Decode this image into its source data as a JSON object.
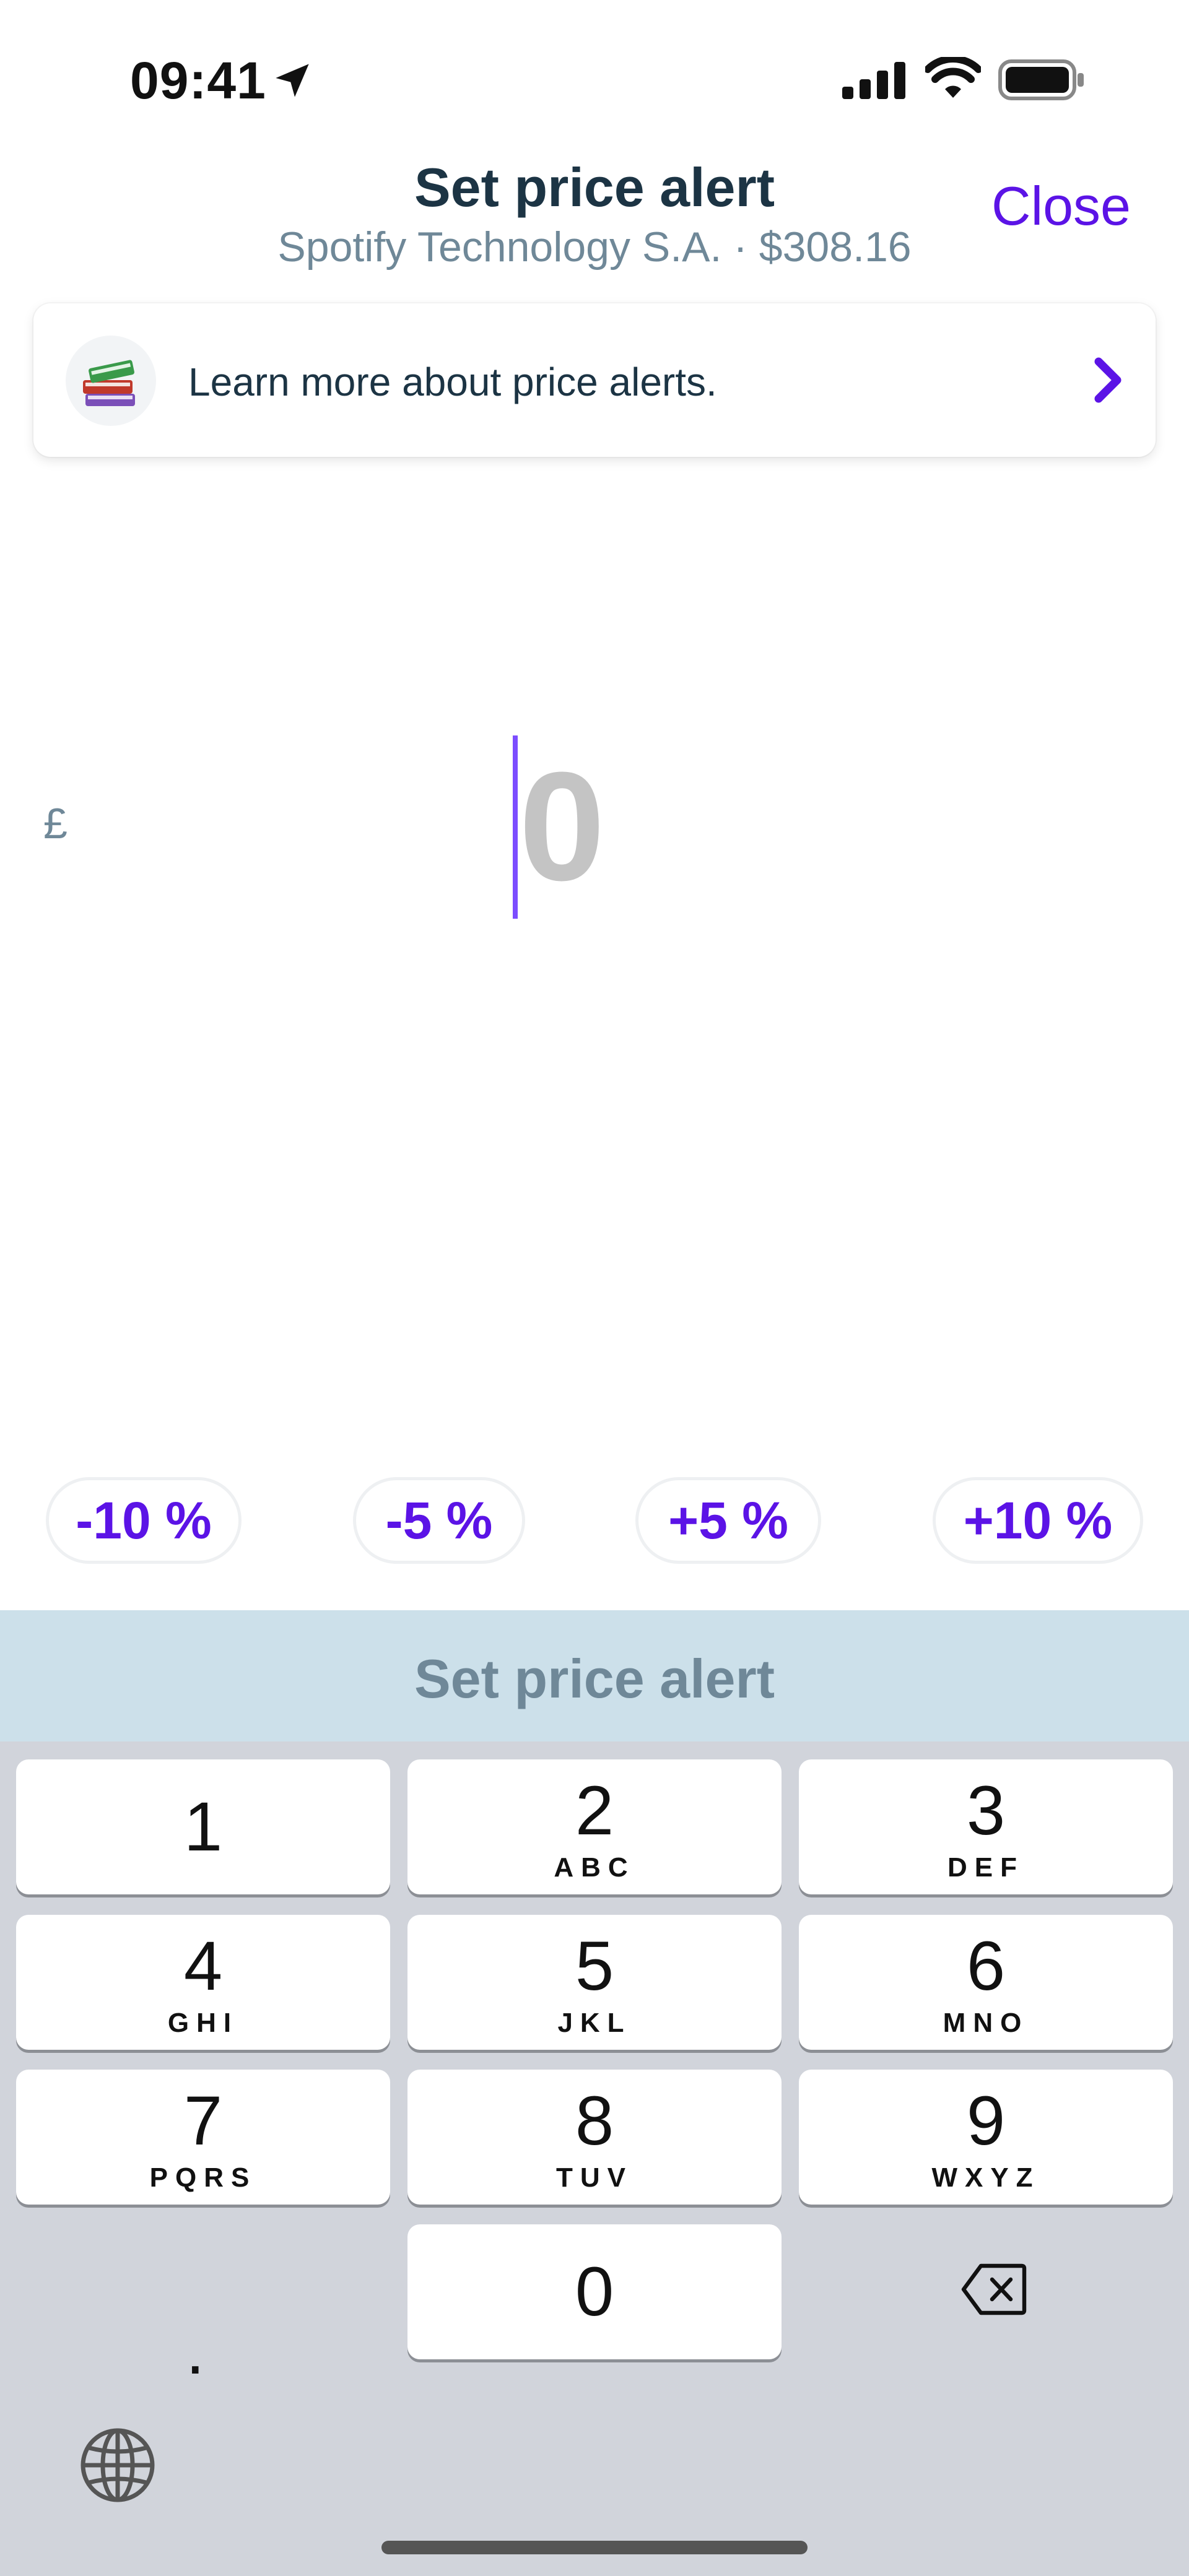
{
  "status_bar": {
    "time": "09:41"
  },
  "header": {
    "title": "Set price alert",
    "subtitle": "Spotify Technology S.A. · $308.16",
    "close_label": "Close"
  },
  "info_card": {
    "text": "Learn more about price alerts."
  },
  "amount": {
    "currency": "£",
    "value": "0"
  },
  "quick_adjust": [
    {
      "label": "-10 %"
    },
    {
      "label": "-5 %"
    },
    {
      "label": "+5 %"
    },
    {
      "label": "+10 %"
    }
  ],
  "set_alert_button": {
    "label": "Set price alert"
  },
  "keypad": {
    "keys": [
      {
        "num": "1",
        "letters": ""
      },
      {
        "num": "2",
        "letters": "ABC"
      },
      {
        "num": "3",
        "letters": "DEF"
      },
      {
        "num": "4",
        "letters": "GHI"
      },
      {
        "num": "5",
        "letters": "JKL"
      },
      {
        "num": "6",
        "letters": "MNO"
      },
      {
        "num": "7",
        "letters": "PQRS"
      },
      {
        "num": "8",
        "letters": "TUV"
      },
      {
        "num": "9",
        "letters": "WXYZ"
      },
      {
        "num": "0",
        "letters": ""
      }
    ],
    "decimal": "."
  },
  "colors": {
    "accent": "#5b13e6",
    "title": "#1c3444",
    "muted": "#6f8898",
    "set_bar": "#cce0ea",
    "keyboard_bg": "#d1d4db"
  }
}
